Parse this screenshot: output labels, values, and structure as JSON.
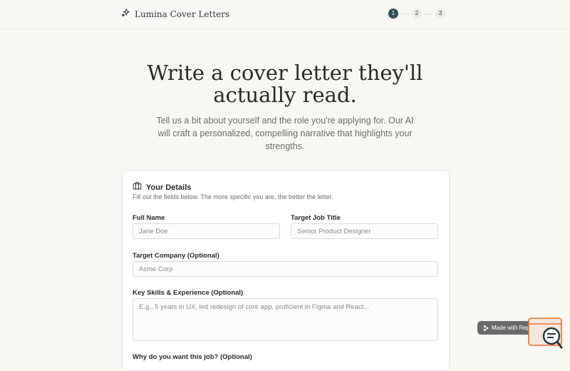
{
  "header": {
    "brand_name": "Lumina Cover Letters",
    "steps": [
      "1",
      "2",
      "3"
    ],
    "active_step": "1"
  },
  "hero": {
    "title": "Write a cover letter they'll actually read.",
    "subtitle": "Tell us a bit about yourself and the role you're applying for. Our AI will craft a personalized, compelling narrative that highlights your strengths."
  },
  "form": {
    "title": "Your Details",
    "description": "Fill out the fields below. The more specific you are, the better the letter.",
    "full_name": {
      "label": "Full Name",
      "placeholder": "Jane Doe",
      "value": ""
    },
    "job_title": {
      "label": "Target Job Title",
      "placeholder": "Senior Product Designer",
      "value": ""
    },
    "company": {
      "label": "Target Company (Optional)",
      "placeholder": "Acme Corp",
      "value": ""
    },
    "skills": {
      "label": "Key Skills & Experience (Optional)",
      "placeholder": "E.g., 5 years in UX, led redesign of core app, proficient in Figma and React...",
      "value": ""
    },
    "why": {
      "label": "Why do you want this job? (Optional)"
    }
  },
  "badge": {
    "text": "Made with Replit"
  },
  "colors": {
    "accent": "#2e5159",
    "background": "#f8f7f4",
    "card": "#ffffff",
    "widget": "#e8702a"
  },
  "icons": {
    "brand": "sparkles-icon",
    "card": "briefcase-icon",
    "badge": "replit-icon",
    "chat": "chat-search-icon"
  }
}
